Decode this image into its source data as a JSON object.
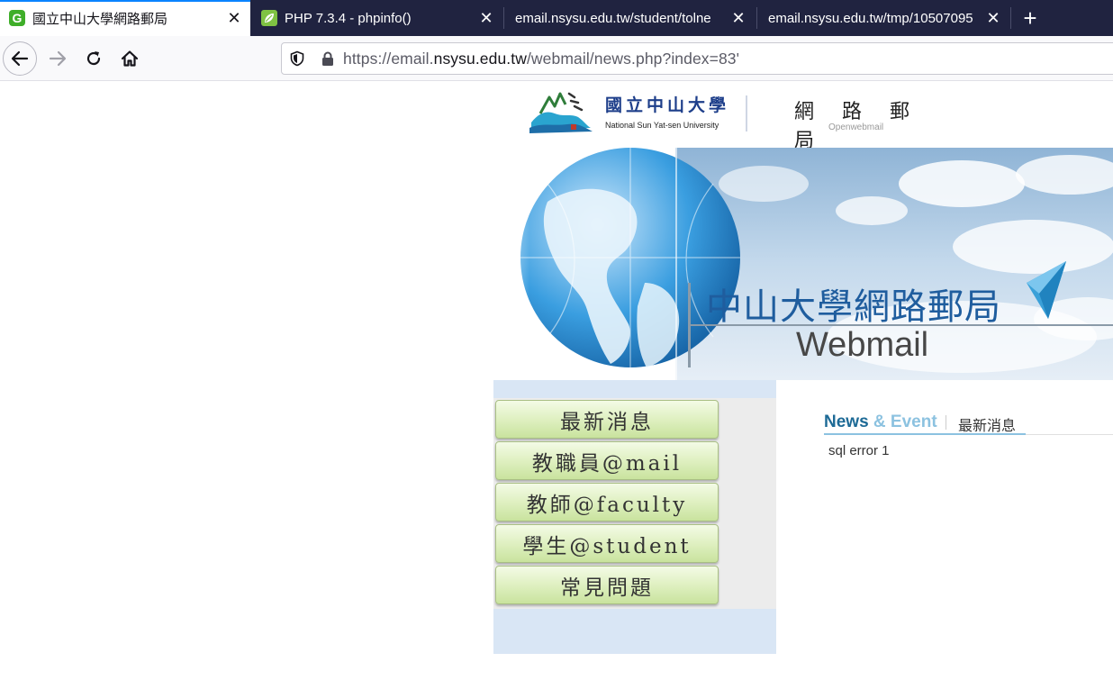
{
  "tabs": [
    {
      "title": "國立中山大學網路郵局",
      "favicon": "g-icon",
      "active": true
    },
    {
      "title": "PHP 7.3.4 - phpinfo()",
      "favicon": "php-leaf-icon",
      "active": false
    },
    {
      "title": "email.nsysu.edu.tw/student/tolne",
      "favicon": "",
      "active": false
    },
    {
      "title": "email.nsysu.edu.tw/tmp/10507095",
      "favicon": "",
      "active": false
    }
  ],
  "address_bar": {
    "prefix": "https://email.",
    "domain": "nsysu.edu.tw",
    "suffix": "/webmail/news.php?index=83'"
  },
  "header": {
    "university_cn": "國立中山大學",
    "university_en": "National Sun Yat-sen University",
    "service_title": "網 路 郵 局",
    "service_subtitle": "Openwebmail"
  },
  "banner": {
    "title": "中山大學網路郵局",
    "subtitle": "Webmail"
  },
  "menu": [
    {
      "label": "最新消息"
    },
    {
      "label": "教職員@mail"
    },
    {
      "label": "教師@faculty"
    },
    {
      "label": "學生@student"
    },
    {
      "label": "常見問題"
    }
  ],
  "news": {
    "heading_en_1": "News",
    "heading_en_2": " & Event",
    "heading_cn": "最新消息",
    "body": "sql error 1"
  },
  "colors": {
    "tab_strip": "#202340",
    "active_tab_accent": "#0a84ff",
    "menu_gradient_top": "#f4fbe6",
    "menu_gradient_bottom": "#c9e39e",
    "news_blue": "#1d6a96",
    "banner_blue": "#1f5d9e"
  }
}
